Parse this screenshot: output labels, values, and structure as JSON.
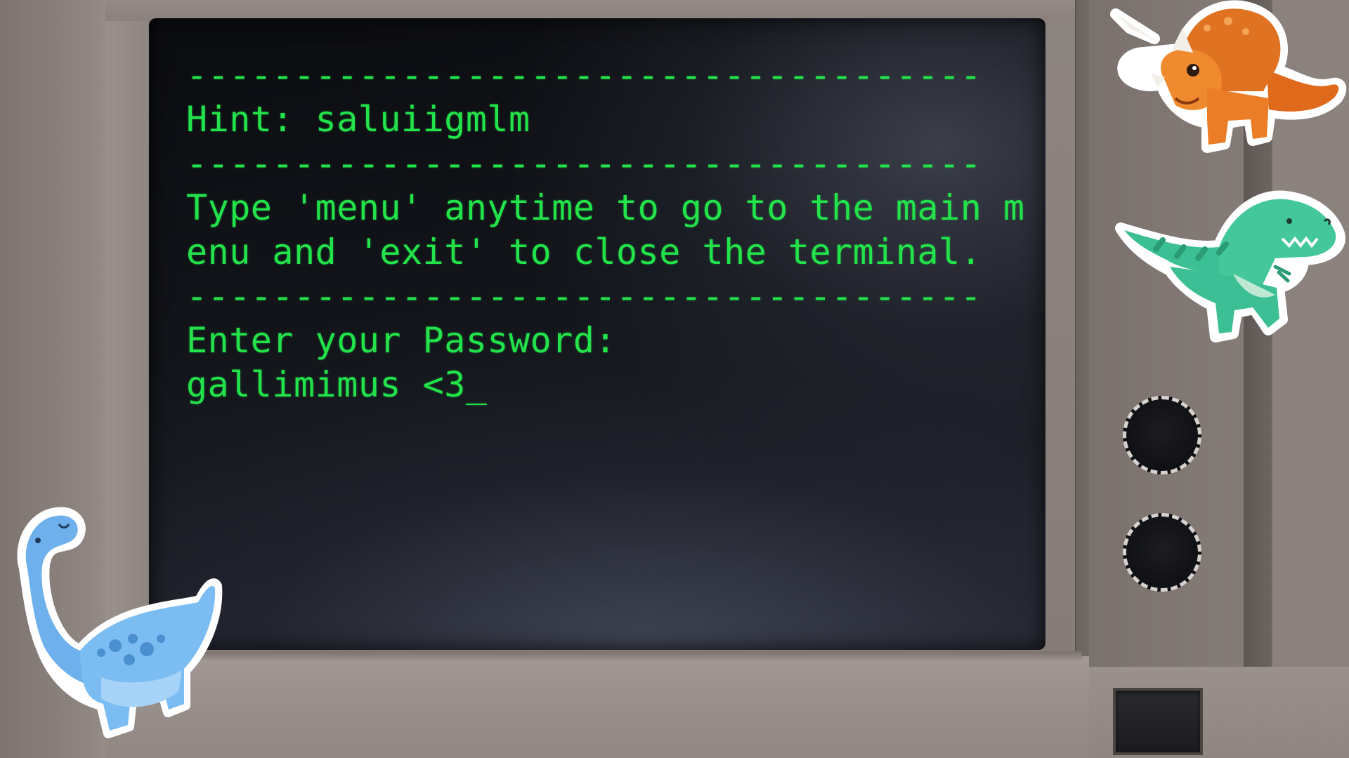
{
  "terminal": {
    "lines": [
      "-------------------------------------",
      "Hint: saluiigmlm",
      "-------------------------------------",
      "Type 'menu' anytime to go to the main m",
      "enu and 'exit' to close the terminal.",
      "-------------------------------------",
      "Enter your Password:",
      "gallimimus <3_"
    ]
  },
  "colors": {
    "terminal_text": "#22e34a",
    "screen_bg": "#13151b",
    "case": "#8a807c"
  },
  "stickers": {
    "top_right": "triceratops-sticker-icon",
    "middle_right": "trex-sticker-icon",
    "bottom_left": "brachiosaurus-sticker-icon"
  }
}
